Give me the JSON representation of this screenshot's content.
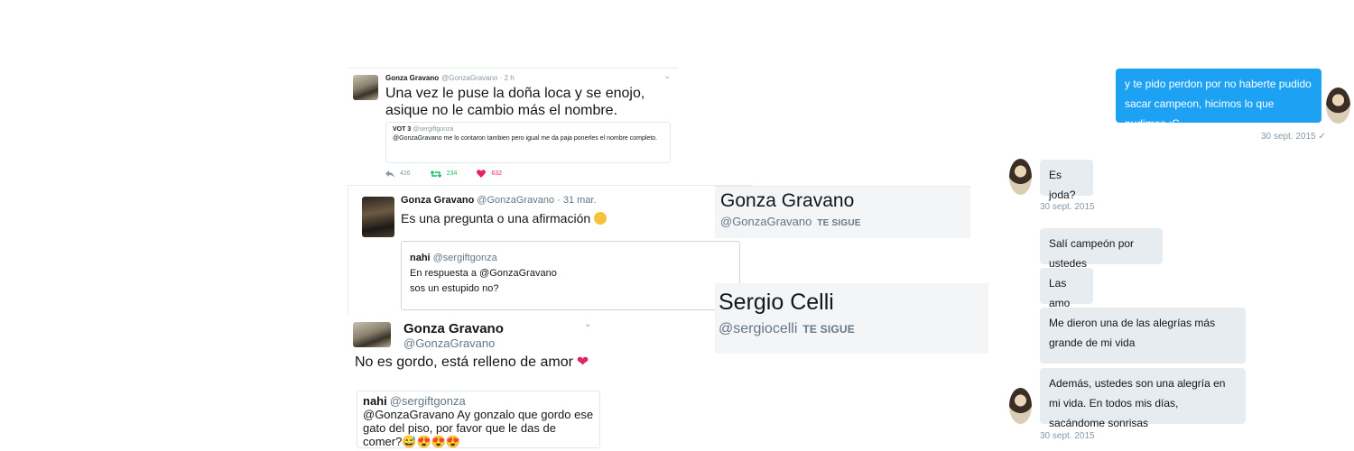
{
  "tweet1": {
    "author_name": "Gonza Gravano",
    "author_handle": "@GonzaGravano · 2 h",
    "caret": "⌄",
    "text": "Una vez le puse la doña loca y se enojo, asique no le cambio más el nombre.",
    "quote": {
      "name": "VOT 3",
      "handle": "@sergiftgonza",
      "text": "@GonzaGravano me lo contaron tambien pero igual me da paja ponerles el nombre completo."
    },
    "reply_count": "426",
    "retweet_count": "234",
    "like_count": "632"
  },
  "tweet2": {
    "author_name": "Gonza Gravano",
    "author_handle": "@GonzaGravano · 31 mar.",
    "text": "Es una pregunta o una afirmación",
    "quote": {
      "name": "nahi",
      "handle": "@sergiftgonza",
      "reply_to": "En respuesta a @GonzaGravano",
      "text": "sos un estupido no?"
    }
  },
  "tweet3": {
    "author_name": "Gonza Gravano",
    "author_handle": "@GonzaGravano",
    "caret": "⌄",
    "text": "No es gordo, está relleno de amor",
    "quote": {
      "name": "nahi",
      "handle": "@sergiftgonza",
      "text": "@GonzaGravano Ay gonzalo que gordo ese gato del piso, por favor que le das de comer?😅😍😍😍"
    }
  },
  "profile1": {
    "name": "Gonza Gravano",
    "handle": "@GonzaGravano",
    "follows_label": "TE SIGUE"
  },
  "profile2": {
    "name": "Sergio Celli",
    "handle": "@sergiocelli",
    "follows_label": "TE SIGUE"
  },
  "dm": {
    "sent_message": "y te pido perdon por no haberte pudido sacar campeon, hicimos lo que pudimos :C",
    "sent_time": "30 sept. 2015",
    "read_mark": "✓",
    "reply1": "Es joda?",
    "reply1_time": "30 sept. 2015",
    "reply2": "Salí campeón por ustedes",
    "reply3": "Las amo",
    "reply4": "Me dieron una de las alegrías más grande de mi vida",
    "reply5": "Además, ustedes son una alegría en mi vida. En todos mis días, sacándome sonrisas",
    "reply5_time": "30 sept. 2015"
  },
  "colors": {
    "twitter_blue": "#1da1f2",
    "retweet_green": "#17bf63",
    "like_red": "#e0245e",
    "bubble_gray": "#e6ecf0"
  },
  "icons": [
    "reply-icon",
    "retweet-icon",
    "like-icon",
    "thinking-face-icon",
    "heart-icon",
    "chevron-down-icon"
  ]
}
